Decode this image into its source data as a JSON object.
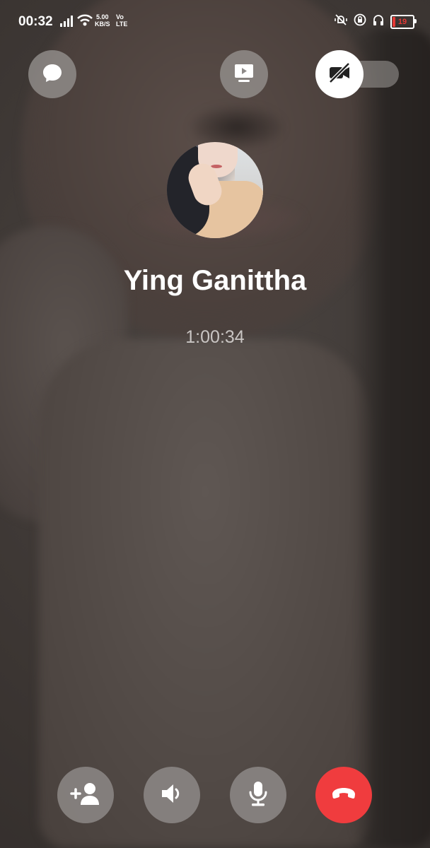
{
  "status_bar": {
    "time": "00:32",
    "network_speed_value": "5.00",
    "network_speed_unit": "KB/S",
    "volte_top": "Vo",
    "volte_bottom": "LTE",
    "battery_level": "19",
    "icons": [
      "signal-icon",
      "wifi-icon",
      "mute-vibrate-icon",
      "alarm-lock-icon",
      "headphones-icon",
      "battery-icon"
    ]
  },
  "top_controls": {
    "chat": {
      "icon": "chat-bubble-icon"
    },
    "share_screen": {
      "icon": "screen-share-icon"
    },
    "video_toggle": {
      "icon": "video-off-icon",
      "state": "off"
    }
  },
  "call": {
    "contact_name": "Ying Ganittha",
    "duration": "1:00:34"
  },
  "bottom_controls": [
    {
      "name": "add-person",
      "icon": "add-person-icon"
    },
    {
      "name": "speaker",
      "icon": "speaker-icon"
    },
    {
      "name": "microphone",
      "icon": "microphone-icon"
    },
    {
      "name": "end-call",
      "icon": "end-call-icon",
      "color": "#f03c3e"
    }
  ],
  "colors": {
    "accent_end_call": "#f03c3e",
    "button_bg": "#969290",
    "battery_low": "#e53935"
  }
}
